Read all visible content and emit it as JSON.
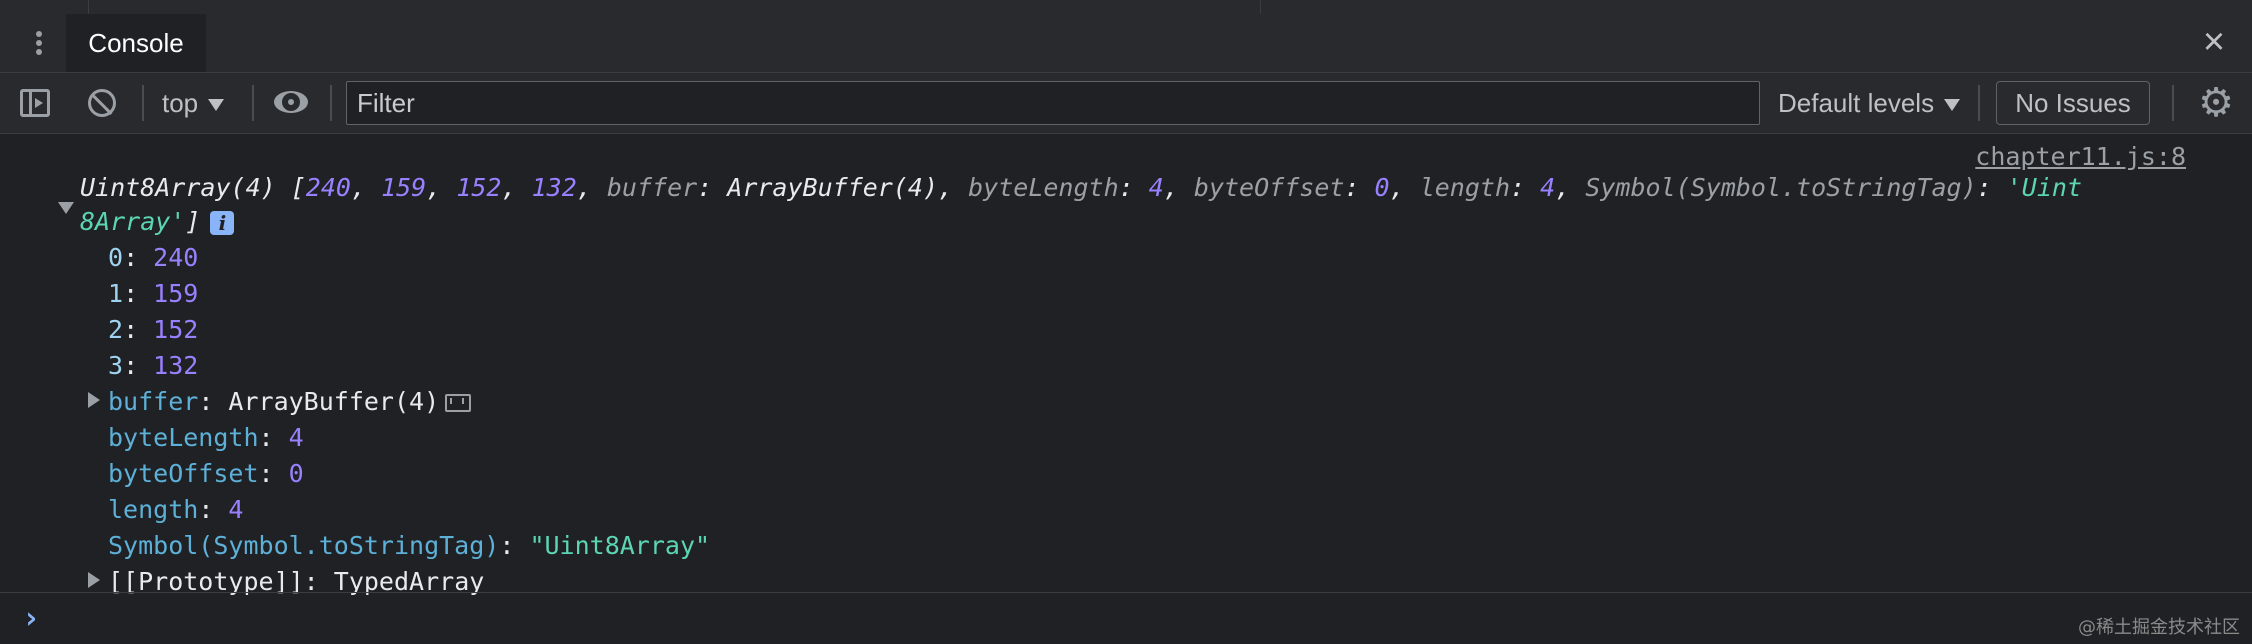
{
  "tabs": {
    "console_label": "Console"
  },
  "toolbar": {
    "context": "top",
    "filter_placeholder": "Filter",
    "levels": "Default levels",
    "issues": "No Issues"
  },
  "console": {
    "source_link": "chapter11.js:8",
    "summary": {
      "type": "Uint8Array(4)",
      "open_bracket": "[",
      "v0": "240",
      "v1": "159",
      "v2": "152",
      "v3": "132",
      "k_buffer": "buffer",
      "v_buffer": "ArrayBuffer(4)",
      "k_byteLength": "byteLength",
      "v_byteLength": "4",
      "k_byteOffset": "byteOffset",
      "v_byteOffset": "0",
      "k_length": "length",
      "v_length": "4",
      "k_tag": "Symbol(Symbol.toStringTag)",
      "v_tag_part1": "'Uint",
      "v_tag_part2": "8Array'",
      "close_bracket": "]",
      "info": "i"
    },
    "entries": [
      {
        "key": "0",
        "value": "240"
      },
      {
        "key": "1",
        "value": "159"
      },
      {
        "key": "2",
        "value": "152"
      },
      {
        "key": "3",
        "value": "132"
      }
    ],
    "props": {
      "buffer_key": "buffer",
      "buffer_value": "ArrayBuffer(4)",
      "byteLength_key": "byteLength",
      "byteLength_value": "4",
      "byteOffset_key": "byteOffset",
      "byteOffset_value": "0",
      "length_key": "length",
      "length_value": "4",
      "tag_key": "Symbol(Symbol.toStringTag)",
      "tag_value": "\"Uint8Array\"",
      "proto_key": "[[Prototype]]",
      "proto_value": "TypedArray"
    },
    "prompt": "›"
  },
  "watermark": "@稀土掘金技术社区",
  "colors": {
    "background": "#202124",
    "toolbar": "#292a2d",
    "number": "#9980ff",
    "string": "#5cd5b4",
    "key": "#5db0d7"
  }
}
